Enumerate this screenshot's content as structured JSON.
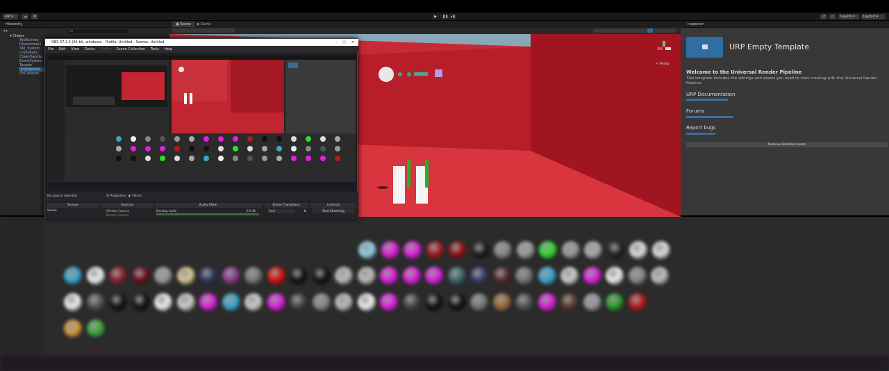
{
  "toolbar": {
    "account_label": "AM",
    "layers_label": "Layers",
    "layout_label": "Layout"
  },
  "hierarchy": {
    "tab_label": "Hierarchy",
    "search_placeholder": "All",
    "root": "Chains",
    "items": [
      "TestScenes",
      "DirectionalLi",
      "SNI_System",
      "CrazyBalls",
      "ChainHandle",
      "EventSystem",
      "Targets",
      "DropSphere",
      "OnCollision"
    ]
  },
  "scene": {
    "tabs": [
      "Scene",
      "Game"
    ],
    "persp_label": "< Persp"
  },
  "inspector": {
    "tab_label": "Inspector",
    "title": "URP Empty Template",
    "welcome_heading": "Welcome to the Universal Render Pipeline",
    "welcome_text": "This template includes the settings and assets you need to start creating with the Universal Render Pipeline.",
    "doc_heading": "URP Documentation",
    "forums_heading": "Forums",
    "bugs_heading": "Report bugs",
    "remove_button": "Remove Readme Assets"
  },
  "obs": {
    "title": "OBS 27.2.4 (64-bit, windows) - Profile: Untitled - Scenes: Untitled",
    "menu": [
      "File",
      "Edit",
      "View",
      "Docks",
      "Profile",
      "Scene Collection",
      "Tools",
      "Help"
    ],
    "no_source": "No source selected",
    "properties": "Properties",
    "filters": "Filters",
    "docks": [
      "Scenes",
      "Sources",
      "Audio Mixer",
      "Scene Transitions",
      "Controls"
    ],
    "scene_item": "Scene",
    "transition_value": "Fade",
    "source_item": "Window Capture",
    "source_item2": "Display Capture",
    "mixer_label": "Desktop Audio",
    "mixer_level": "0.0 dB",
    "start_streaming": "Start Streaming"
  },
  "colors": {
    "accent": "#2f6ea3",
    "red_wall": "#c8202a",
    "inspector_bg": "#383838"
  }
}
